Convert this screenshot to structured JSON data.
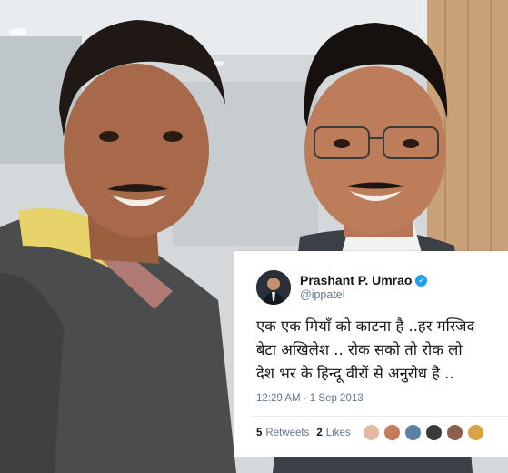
{
  "tweet": {
    "display_name": "Prashant P. Umrao",
    "handle": "@ippatel",
    "verified_icon": "verified-badge-icon",
    "lines": [
      "एक एक मियाँ को काटना है ..हर मस्जिद",
      "बेटा अखिलेश .. रोक सको तो रोक लो",
      "देश भर के हिन्दू वीरों से अनुरोध है .."
    ],
    "timestamp": "12:29 AM - 1 Sep 2013",
    "retweets_count": "5",
    "retweets_label": "Retweets",
    "likes_count": "2",
    "likes_label": "Likes",
    "liker_avatars": [
      "#e7b9a0",
      "#c47b5a",
      "#5a7fa8",
      "#3b3b3b",
      "#8b5e4f",
      "#d9a441"
    ]
  },
  "colors": {
    "accent": "#1da1f2",
    "text_primary": "#14171a",
    "text_secondary": "#657786"
  }
}
